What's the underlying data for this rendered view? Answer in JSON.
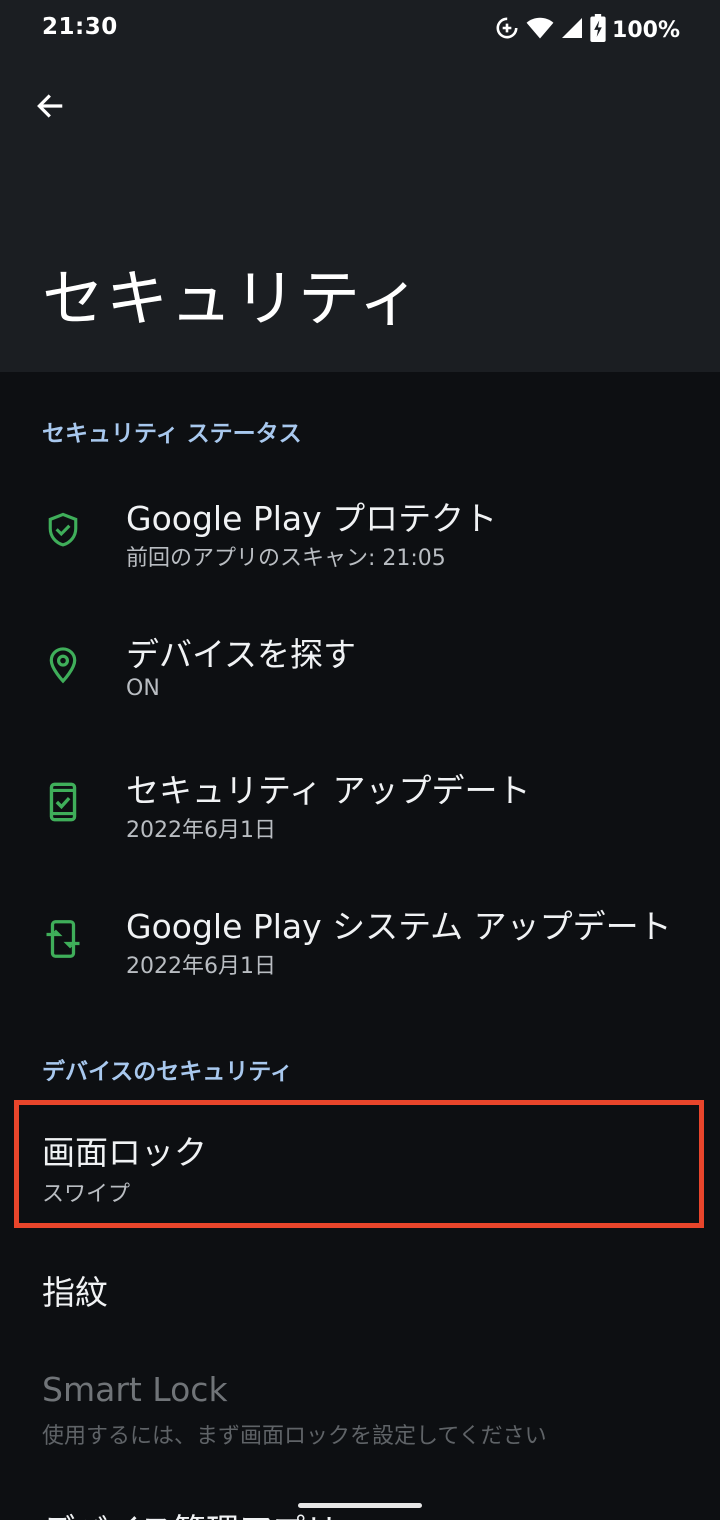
{
  "status_bar": {
    "time": "21:30",
    "battery": "100%",
    "icons": [
      "data-saver-icon",
      "wifi-icon",
      "signal-icon",
      "battery-charging-icon"
    ]
  },
  "app_bar": {
    "back_icon": "arrow-back-icon",
    "title": "セキュリティ"
  },
  "sections": {
    "security_status": {
      "header": "セキュリティ ステータス",
      "items": [
        {
          "title": "Google Play プロテクト",
          "subtitle": "前回のアプリのスキャン: 21:05",
          "icon": "shield-check-icon"
        },
        {
          "title": "デバイスを探す",
          "subtitle": "ON",
          "icon": "location-pin-icon"
        },
        {
          "title": "セキュリティ アップデート",
          "subtitle": "2022年6月1日",
          "icon": "phone-check-icon"
        },
        {
          "title": "Google Play システム アップデート",
          "subtitle": "2022年6月1日",
          "icon": "phone-sync-icon"
        }
      ]
    },
    "device_security": {
      "header": "デバイスのセキュリティ",
      "items": [
        {
          "title": "画面ロック",
          "subtitle": "スワイプ"
        },
        {
          "title": "指紋"
        },
        {
          "title": "Smart Lock",
          "subtitle": "使用するには、まず画面ロックを設定してください"
        },
        {
          "title": "デバイス管理アプリ"
        }
      ]
    }
  },
  "colors": {
    "background": "#0d0f12",
    "app_bar": "#1b1e22",
    "accent_header": "#a8c8ee",
    "icon_green": "#3fae5a",
    "highlight": "#e8452b"
  }
}
